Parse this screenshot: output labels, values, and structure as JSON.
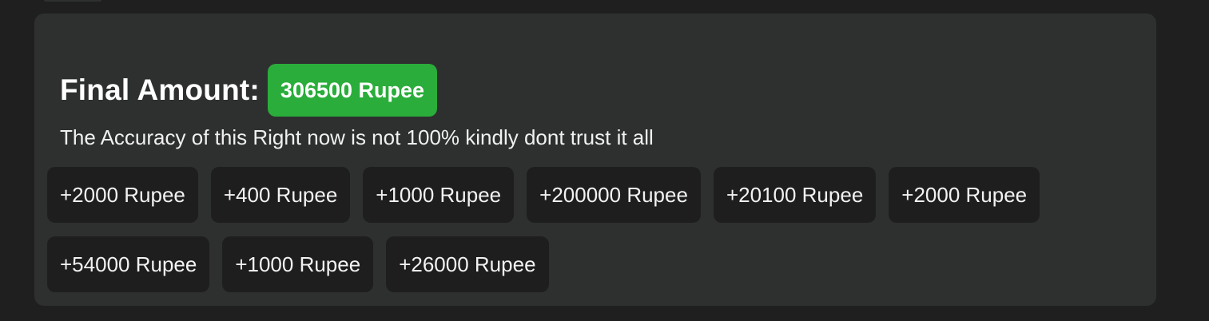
{
  "summary": {
    "label": "Final Amount:",
    "amount": "306500 Rupee"
  },
  "disclaimer": "The Accuracy of this Right now is not 100% kindly dont trust it all",
  "entries": [
    "+2000 Rupee",
    "+400 Rupee",
    "+1000 Rupee",
    "+200000 Rupee",
    "+20100 Rupee",
    "+2000 Rupee",
    "+54000 Rupee",
    "+1000 Rupee",
    "+26000 Rupee"
  ],
  "colors": {
    "page_background": "#1f1f1f",
    "panel_background": "#2e3030",
    "badge_green": "#2aad3a",
    "chip_background": "#1e1e1e"
  }
}
